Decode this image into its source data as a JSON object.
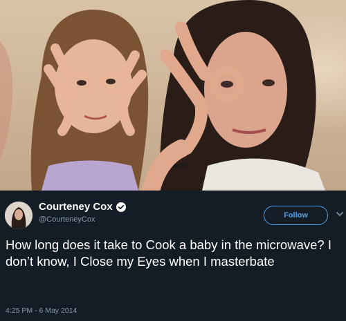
{
  "tweet": {
    "display_name": "Courteney Cox",
    "handle": "@CourteneyCox",
    "verified": true,
    "follow_label": "Follow",
    "text": "How long does it take to Cook a baby in the microwave? I don’t know, I Close my Eyes when I masterbate",
    "timestamp": "4:25 PM - 6 May 2014"
  },
  "icons": {
    "verified": "verified-badge-icon",
    "caret": "chevron-down-icon",
    "avatar": "profile-avatar"
  },
  "colors": {
    "background": "#141d26",
    "text": "#ffffff",
    "muted": "#8899a6",
    "accent": "#4aa1eb"
  }
}
